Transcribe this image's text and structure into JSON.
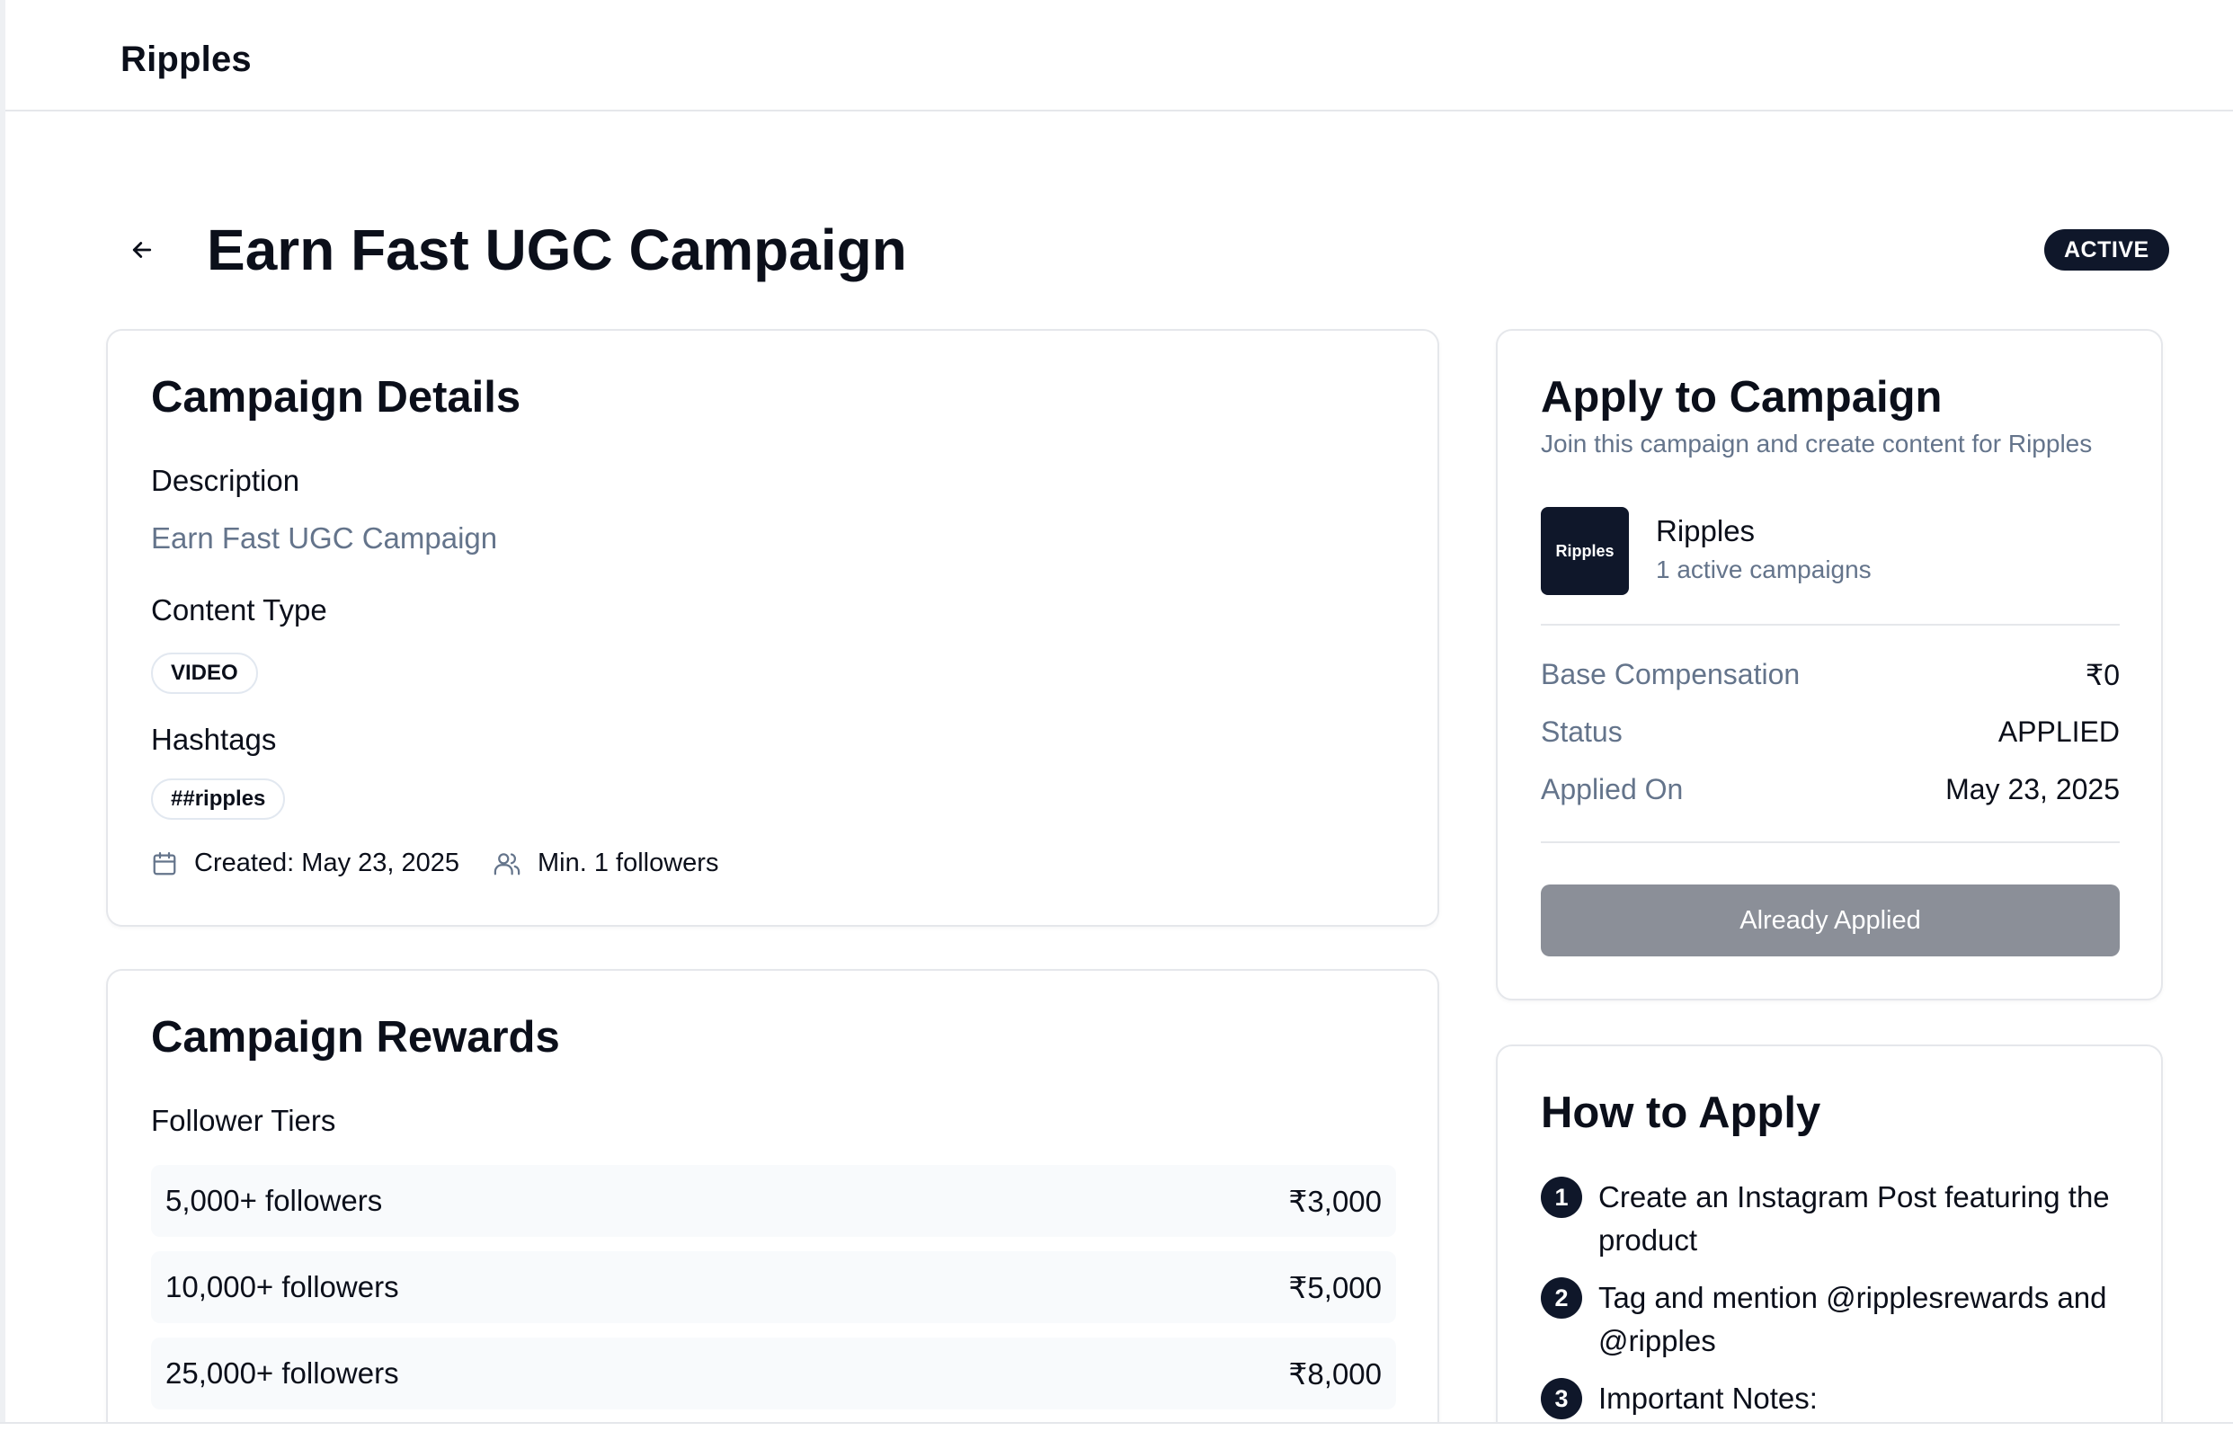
{
  "app": {
    "brand": "Ripples"
  },
  "header": {
    "title": "Earn Fast UGC Campaign",
    "status_badge": "ACTIVE"
  },
  "details": {
    "title": "Campaign Details",
    "description_label": "Description",
    "description": "Earn Fast UGC Campaign",
    "content_type_label": "Content Type",
    "content_type": "VIDEO",
    "hashtags_label": "Hashtags",
    "hashtags": [
      "##ripples"
    ],
    "created": "Created: May 23, 2025",
    "min_followers": "Min. 1 followers"
  },
  "rewards": {
    "title": "Campaign Rewards",
    "tiers_label": "Follower Tiers",
    "tiers": [
      {
        "label": "5,000+ followers",
        "amount": "₹3,000"
      },
      {
        "label": "10,000+ followers",
        "amount": "₹5,000"
      },
      {
        "label": "25,000+ followers",
        "amount": "₹8,000"
      }
    ]
  },
  "apply": {
    "title": "Apply to Campaign",
    "subtitle": "Join this campaign and create content for Ripples",
    "brand_logo_text": "Ripples",
    "brand_name": "Ripples",
    "brand_campaigns": "1 active campaigns",
    "rows": [
      {
        "key": "Base Compensation",
        "value": "₹0"
      },
      {
        "key": "Status",
        "value": "APPLIED"
      },
      {
        "key": "Applied On",
        "value": "May 23, 2025"
      }
    ],
    "button_label": "Already Applied"
  },
  "howto": {
    "title": "How to Apply",
    "steps": [
      {
        "num": "1",
        "text": "Create an Instagram Post featuring the product"
      },
      {
        "num": "2",
        "text": "Tag and mention @ripplesrewards and @ripples"
      },
      {
        "num": "3",
        "text": "Important Notes:"
      }
    ]
  },
  "icons": [
    "arrow-left-icon",
    "calendar-icon",
    "users-icon"
  ],
  "colors": {
    "primary": "#0f172a",
    "muted": "#64748b",
    "disabled_button": "#8b8f98"
  }
}
